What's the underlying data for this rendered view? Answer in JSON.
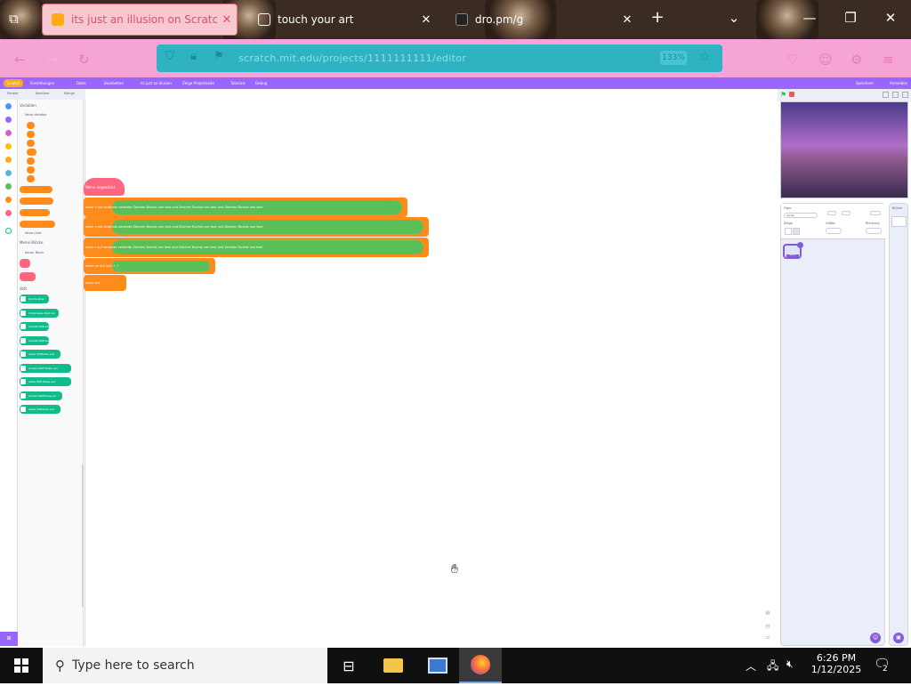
{
  "browser": {
    "tabs": [
      {
        "title": "its just an illusion on Scratch",
        "active": true,
        "icon": "scratch-icon"
      },
      {
        "title": "touch your art",
        "active": false,
        "icon": "page-icon"
      },
      {
        "title": "dro.pm/g",
        "active": false,
        "icon": "page-icon"
      }
    ],
    "new_tab_label": "+",
    "url": "scratch.mit.edu/projects/1111111111/editor",
    "zoom": "133%"
  },
  "scratch_menu": {
    "logo": "Scratch",
    "items": [
      "Einstellungen",
      "Datei",
      "Bearbeiten",
      "its just an illusion",
      "Zeige Projektseite",
      "Tutorials",
      "Debug"
    ],
    "right_items": [
      "Speichern",
      "Anmelden"
    ]
  },
  "editor_tabs": [
    "Skripte",
    "Kostüme",
    "Klänge"
  ],
  "palette": {
    "section_variables": "Variablen",
    "make_var_button": "Neue Variable",
    "section_lists": "Meine Blöcke",
    "make_block_button": "Neuer Block",
    "section_ext": "Stift",
    "ext_blocks": [
      "lösche alles",
      "hinterlasse Abdruck",
      "schalte Stift ein",
      "schalte Stift aus",
      "setze Stiftfarbe auf",
      "ändere Stift Farbe um",
      "setze Stift Farbe auf",
      "ändere Stiftdicke um",
      "setze Stiftdicke auf"
    ]
  },
  "workspace": {
    "hat_label": "Wenn angeklickt",
    "blocks": [
      "setze x auf verbinde verbinde Zeichen Buchst von text und Zeichen Buchst von text und Zeichen Buchst von text",
      "setze y auf verbinde verbinde Zeichen Buchst von text und Zeichen Buchst von text und Zeichen Buchst von text",
      "setze z auf verbinde verbinde Zeichen Buchst von text und Zeichen Buchst von text und Zeichen Buchst von text",
      "setze dir auf und  +  +  ",
      "setze  auf "
    ]
  },
  "sprite_info": {
    "sprite_label": "Figur",
    "sprite_name": "sprite",
    "show_label": "Zeige",
    "size_label": "Größe",
    "direction_label": "Richtung",
    "sprite_thumb": "Sprite1"
  },
  "stage_panel": {
    "label": "Bühne"
  },
  "taskbar": {
    "search_placeholder": "Type here to search",
    "time": "6:26 PM",
    "date": "1/12/2025",
    "notif_count": "2"
  },
  "colors": {
    "scratch_purple": "#9966ff",
    "event_orange": "#ffbf00",
    "variable_orange": "#ff8c1a",
    "operator_green": "#59c059",
    "pen_teal": "#0fbd8c",
    "myblocks_pink": "#ff6680"
  }
}
